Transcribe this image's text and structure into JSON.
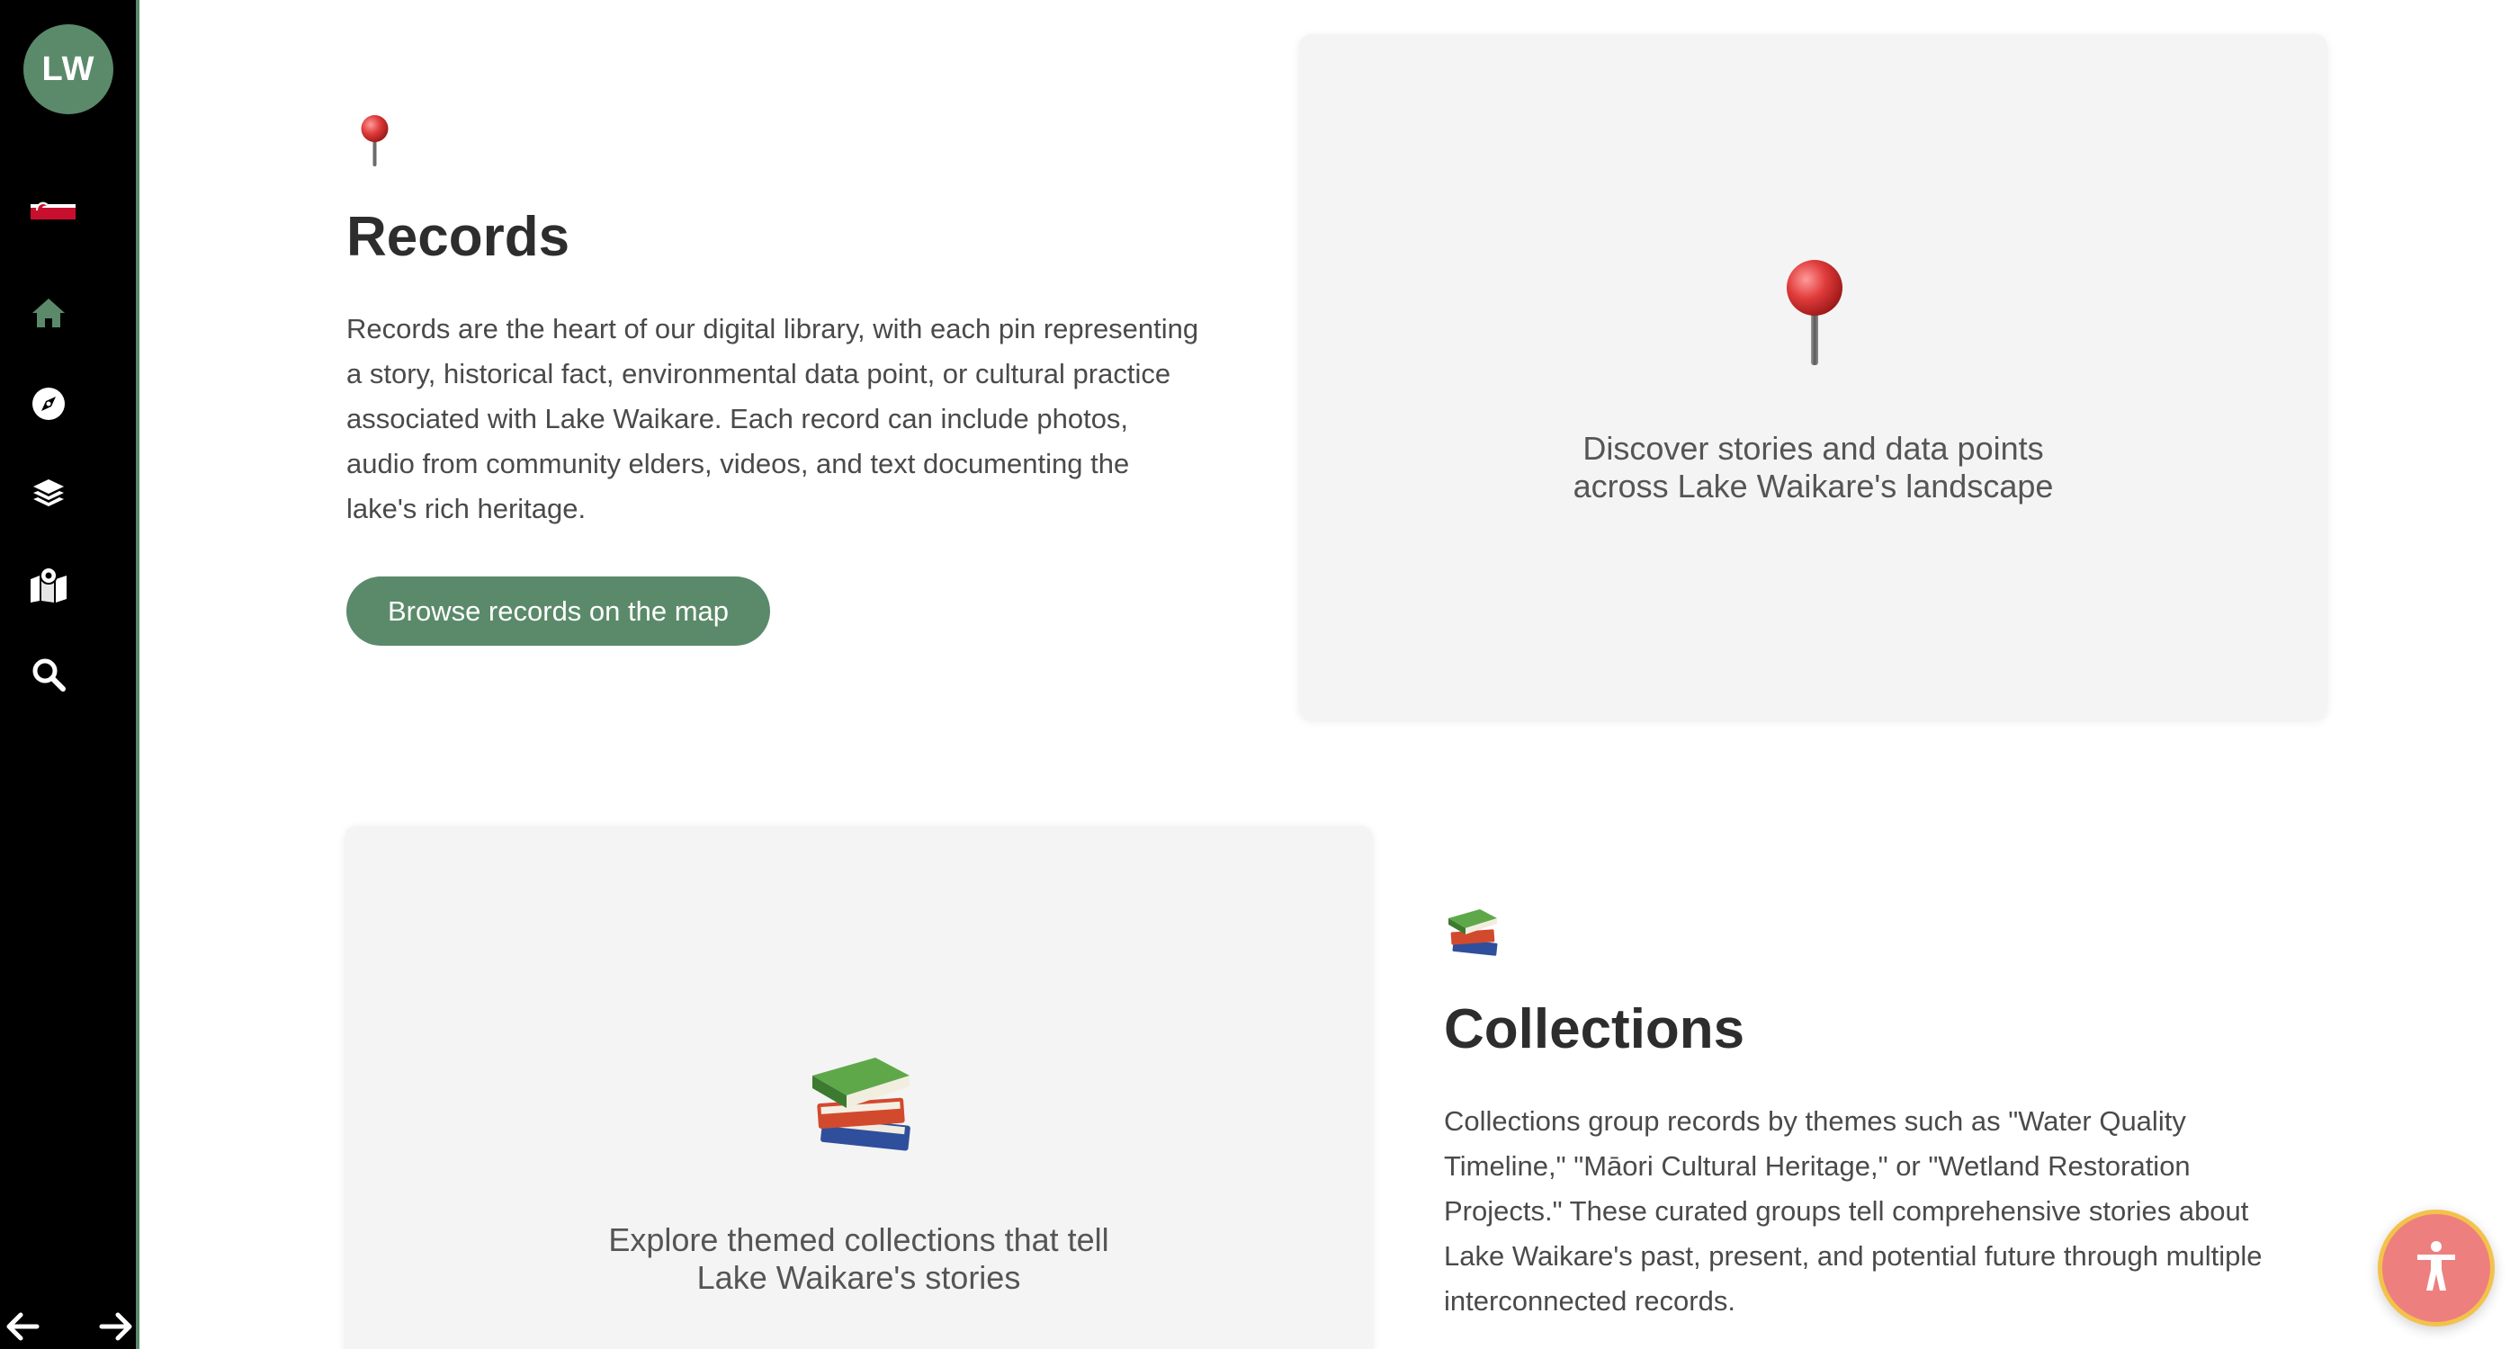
{
  "sidebar": {
    "avatar_initials": "LW",
    "icons": [
      "flag-icon",
      "home-icon",
      "compass-icon",
      "layers-icon",
      "map-pin-icon",
      "search-icon"
    ],
    "accent_color": "#5a8a6a",
    "back_icon": "arrow-left-icon",
    "forward_icon": "arrow-right-icon"
  },
  "records": {
    "icon": "pushpin-icon",
    "title": "Records",
    "paragraph_lines": [
      "Records are the heart of our digital library, with each pin representing",
      "a story, historical fact, environmental data point, or cultural practice",
      "associated with Lake Waikare. Each record can include photos,",
      "audio from community elders, videos, and text documenting the",
      "lake's rich heritage."
    ],
    "button_label": "Browse records on the map",
    "card": {
      "icon": "pushpin-icon",
      "caption_lines": [
        "Discover stories and data points",
        "across Lake Waikare's landscape"
      ]
    }
  },
  "collections": {
    "icon": "books-icon",
    "title": "Collections",
    "paragraph_lines": [
      "Collections group records by themes such as \"Water Quality",
      "Timeline,\" \"Māori Cultural Heritage,\" or \"Wetland Restoration",
      "Projects.\" These curated groups tell comprehensive stories about",
      "Lake Waikare's past, present, and potential future through multiple",
      "interconnected records."
    ],
    "card": {
      "icon": "books-icon",
      "caption_lines": [
        "Explore themed collections that tell",
        "Lake Waikare's stories"
      ]
    }
  },
  "accessibility": {
    "icon": "accessibility-person-icon",
    "fill_color": "#ee7f7f",
    "ring_color": "#f3c24a"
  }
}
